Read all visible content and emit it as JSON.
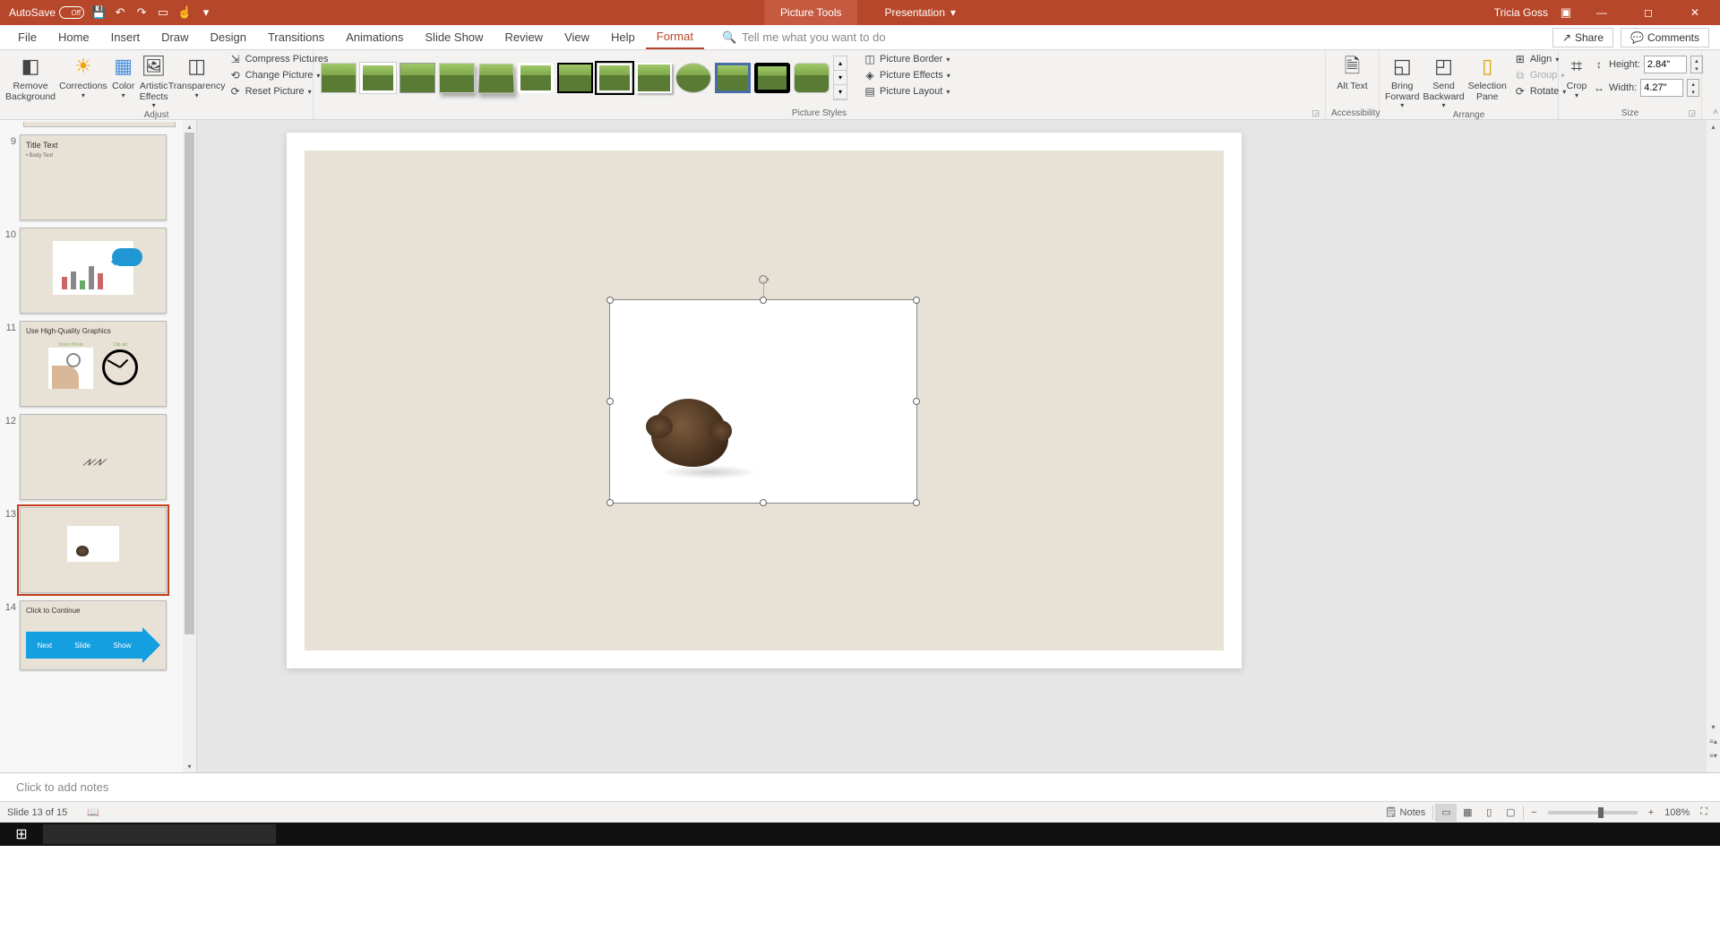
{
  "titlebar": {
    "autosave_label": "AutoSave",
    "autosave_state": "Off",
    "contextual_tab": "Picture Tools",
    "doc_title": "Presentation",
    "user_name": "Tricia Goss"
  },
  "tabs": {
    "file": "File",
    "home": "Home",
    "insert": "Insert",
    "draw": "Draw",
    "design": "Design",
    "transitions": "Transitions",
    "animations": "Animations",
    "slideshow": "Slide Show",
    "review": "Review",
    "view": "View",
    "help": "Help",
    "format": "Format",
    "tellme_placeholder": "Tell me what you want to do",
    "share": "Share",
    "comments": "Comments"
  },
  "ribbon": {
    "adjust": {
      "remove_bg": "Remove Background",
      "corrections": "Corrections",
      "color": "Color",
      "artistic": "Artistic Effects",
      "transparency": "Transparency",
      "compress": "Compress Pictures",
      "change": "Change Picture",
      "reset": "Reset Picture",
      "label": "Adjust"
    },
    "styles": {
      "border": "Picture Border",
      "effects": "Picture Effects",
      "layout": "Picture Layout",
      "label": "Picture Styles"
    },
    "accessibility": {
      "alt_text": "Alt Text",
      "label": "Accessibility"
    },
    "arrange": {
      "bring_forward": "Bring Forward",
      "send_backward": "Send Backward",
      "selection_pane": "Selection Pane",
      "align": "Align",
      "group": "Group",
      "rotate": "Rotate",
      "label": "Arrange"
    },
    "size": {
      "crop": "Crop",
      "height_label": "Height:",
      "height_value": "2.84\"",
      "width_label": "Width:",
      "width_value": "4.27\"",
      "label": "Size"
    }
  },
  "thumbnails": {
    "s9": {
      "num": "9",
      "title": "Title Text",
      "body": "• Body Text"
    },
    "s10": {
      "num": "10"
    },
    "s11": {
      "num": "11",
      "title": "Use High-Quality Graphics",
      "label_a": "Vision Photo",
      "label_b": "Clip art"
    },
    "s12": {
      "num": "12"
    },
    "s13": {
      "num": "13"
    },
    "s14": {
      "num": "14",
      "title": "Click to Continue",
      "w1": "Next",
      "w2": "Slide",
      "w3": "Show"
    }
  },
  "notes": {
    "placeholder": "Click to add notes"
  },
  "statusbar": {
    "slide_info": "Slide 13 of 15",
    "notes": "Notes",
    "zoom_pct": "108%"
  }
}
